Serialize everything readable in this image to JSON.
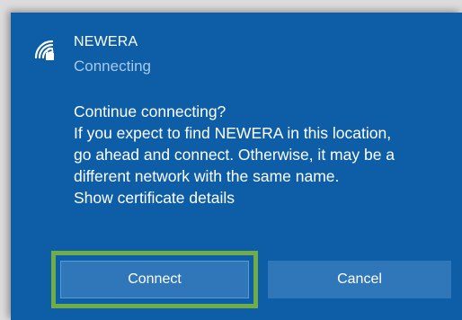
{
  "network": {
    "icon": "wifi-secured-icon",
    "name": "NEWERA",
    "status": "Connecting"
  },
  "prompt": {
    "question": "Continue connecting?",
    "body_lines": [
      "If you expect to find NEWERA in this location,",
      "go ahead and connect. Otherwise, it may be a",
      "different network with the same name."
    ],
    "link": "Show certificate details"
  },
  "buttons": {
    "connect": "Connect",
    "cancel": "Cancel"
  },
  "colors": {
    "panel_bg": "#0d5ea6",
    "button_bg": "#2f77b8",
    "status_text": "#a9c9ea",
    "highlight": "#70ad47"
  }
}
